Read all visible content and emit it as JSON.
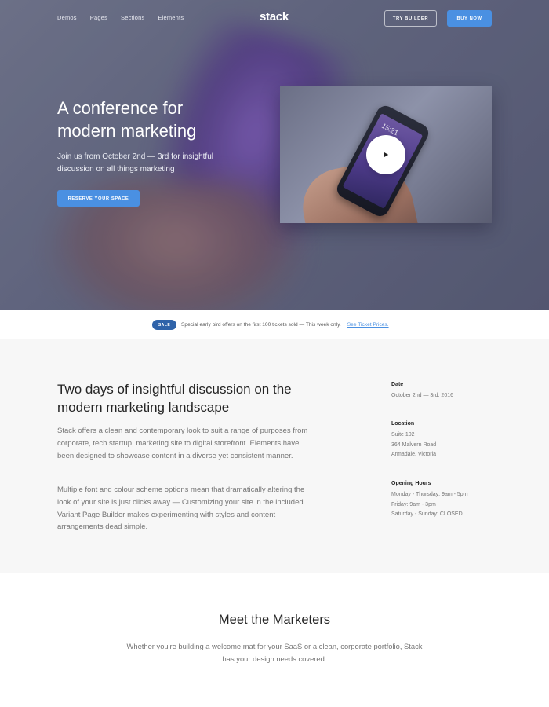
{
  "nav": {
    "links": [
      "Demos",
      "Pages",
      "Sections",
      "Elements"
    ],
    "logo": "stack",
    "try_builder": "TRY BUILDER",
    "buy_now": "BUY NOW"
  },
  "hero": {
    "title": "A conference for modern marketing",
    "subtitle": "Join us from October 2nd — 3rd for insightful discussion on all things marketing",
    "cta": "RESERVE YOUR SPACE",
    "video_time": "15:21"
  },
  "notice": {
    "badge": "SALE",
    "text": "Special early bird offers on the first 100 tickets sold — This week only.",
    "link": "See Ticket Prices."
  },
  "about": {
    "title": "Two days of insightful discussion on the modern marketing landscape",
    "paragraph1": "Stack offers a clean and contemporary look to suit a range of purposes from corporate, tech startup, marketing site to digital storefront. Elements have been designed to showcase content in a diverse yet consistent manner.",
    "paragraph2": "Multiple font and colour scheme options mean that dramatically altering the look of your site is just clicks away — Customizing your site in the included Variant Page Builder makes experimenting with styles and content arrangements dead simple.",
    "date": {
      "label": "Date",
      "lines": [
        "October 2nd — 3rd, 2016"
      ]
    },
    "location": {
      "label": "Location",
      "lines": [
        "Suite 102",
        "364 Malvern Road",
        "Armadale, Victoria"
      ]
    },
    "hours": {
      "label": "Opening Hours",
      "lines": [
        "Monday - Thursday: 9am - 5pm",
        "Friday: 9am - 3pm",
        "Saturday - Sunday: CLOSED"
      ]
    }
  },
  "meet": {
    "title": "Meet the Marketers",
    "subtitle": "Whether you're building a welcome mat for your SaaS or a clean, corporate portfolio, Stack has your design needs covered."
  },
  "colors": {
    "accent": "#4a90e2",
    "badge": "#2f63a9",
    "section_bg": "#f7f7f7"
  },
  "icons": {
    "play": "play-icon"
  }
}
